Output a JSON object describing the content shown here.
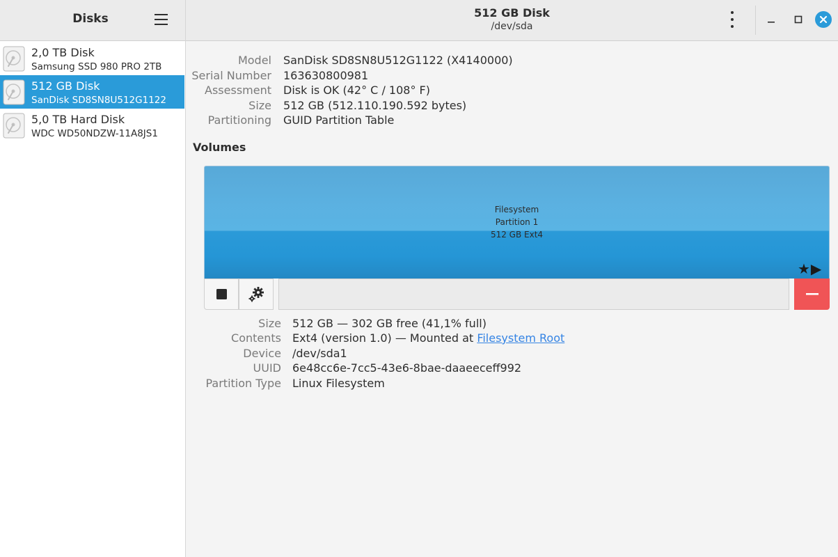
{
  "sidebar": {
    "title": "Disks",
    "disks": [
      {
        "name": "2,0 TB Disk",
        "model": "Samsung SSD 980 PRO 2TB",
        "selected": false
      },
      {
        "name": "512 GB Disk",
        "model": "SanDisk SD8SN8U512G1122",
        "selected": true
      },
      {
        "name": "5,0 TB Hard Disk",
        "model": "WDC WD50NDZW-11A8JS1",
        "selected": false
      }
    ]
  },
  "header": {
    "title": "512 GB Disk",
    "subtitle": "/dev/sda"
  },
  "disk_info": {
    "model_label": "Model",
    "model_value": "SanDisk SD8SN8U512G1122 (X4140000)",
    "serial_label": "Serial Number",
    "serial_value": "163630800981",
    "assessment_label": "Assessment",
    "assessment_value": "Disk is OK (42° C / 108° F)",
    "size_label": "Size",
    "size_value": "512 GB (512.110.190.592 bytes)",
    "partitioning_label": "Partitioning",
    "partitioning_value": "GUID Partition Table"
  },
  "volumes": {
    "heading": "Volumes",
    "partition": {
      "line1": "Filesystem",
      "line2": "Partition 1",
      "line3": "512 GB Ext4",
      "flags": "★▶"
    }
  },
  "volume_info": {
    "size_label": "Size",
    "size_value": "512 GB — 302 GB free (41,1% full)",
    "contents_label": "Contents",
    "contents_prefix": "Ext4 (version 1.0) — Mounted at ",
    "contents_link": "Filesystem Root",
    "device_label": "Device",
    "device_value": "/dev/sda1",
    "uuid_label": "UUID",
    "uuid_value": "6e48cc6e-7cc5-43e6-8bae-daaeeceff992",
    "ptype_label": "Partition Type",
    "ptype_value": "Linux Filesystem"
  },
  "icons": {
    "disk": "drive-harddisk-icon",
    "menu": "hamburger-menu-icon",
    "more": "kebab-menu-icon",
    "minimize": "minimize-icon",
    "maximize": "maximize-icon",
    "close": "close-icon",
    "stop": "stop-icon",
    "settings": "gears-icon",
    "delete": "minus-icon"
  },
  "colors": {
    "accent": "#2a9bd9",
    "destructive": "#f05456",
    "link": "#3584e4"
  }
}
